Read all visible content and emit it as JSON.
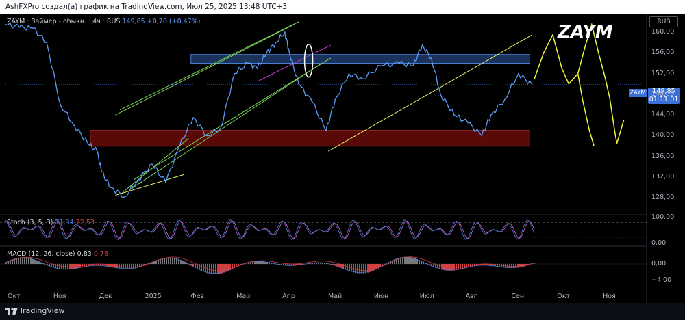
{
  "header": {
    "text": "AshFXPro создал(а) график на TradingView.com, Июл 25, 2025 13:48 UTC+3"
  },
  "legend": {
    "symbol": "ZAYM",
    "description": "· Займер - обыкн. · 4ч · RUS",
    "last": "149,85",
    "change": "+0,70 (+0,47%)"
  },
  "ticker_label": "ZAYM",
  "currency": "RUB",
  "price_tag": {
    "symbol": "ZAYM",
    "price": "149,85",
    "countdown": "01:11:01"
  },
  "stoch": {
    "label": "Stoch (3, 5, 3)",
    "k": "71,34",
    "d": "72,53"
  },
  "macd": {
    "label": "MACD (12, 26, close)",
    "macd": "0,83",
    "signal": "0,78"
  },
  "footer": {
    "brand": "TradingView"
  },
  "colors": {
    "price": "#5b9cf6",
    "accent": "#3a6fd8",
    "zone_support": "#e53935",
    "zone_resistance": "#4a7fd6",
    "channel": "#7cd85a",
    "trendline": "#e5f56a",
    "forecast": "#f2f53d",
    "stoch_k": "#4d78d6",
    "stoch_d": "#c05ec0",
    "macd_pos": "#7a7a7a",
    "macd_neg": "#d04040"
  },
  "chart_data": {
    "type": "line",
    "title": "ZAYM · Займер - обыкн. · 4ч · RUS",
    "x_ticks": [
      "Окт",
      "Ноя",
      "Дек",
      "2025",
      "Фев",
      "Мар",
      "Апр",
      "Май",
      "Июн",
      "Июл",
      "Авг",
      "Сен",
      "Окт",
      "Ноя"
    ],
    "y_ticks": [
      "160,00",
      "156,00",
      "152,00",
      "148,00",
      "144,00",
      "140,00",
      "136,00",
      "132,00",
      "128,00"
    ],
    "ylim": [
      125,
      162
    ],
    "x_domain_months": [
      0,
      14
    ],
    "series": [
      {
        "name": "ZAYM",
        "x": [
          0.0,
          0.3,
          0.6,
          0.9,
          1.2,
          1.5,
          1.8,
          2.0,
          2.1,
          2.3,
          2.6,
          2.9,
          3.2,
          3.5,
          3.8,
          4.1,
          4.4,
          4.7,
          5.0,
          5.3,
          5.5,
          5.7,
          5.9,
          6.1,
          6.2,
          6.4,
          6.7,
          7.0,
          7.2,
          7.5,
          7.8,
          8.2,
          8.6,
          8.9,
          9.1,
          9.3,
          9.5,
          9.8,
          10.1,
          10.4,
          10.6,
          10.9,
          11.2,
          11.5
        ],
        "y": [
          161.5,
          161.0,
          160.8,
          158.0,
          146.0,
          142.0,
          138.5,
          137.0,
          133.0,
          130.0,
          128.2,
          131.5,
          134.5,
          131.0,
          138.0,
          143.5,
          140.0,
          141.5,
          152.0,
          154.0,
          153.0,
          156.0,
          158.0,
          160.0,
          156.0,
          150.0,
          146.5,
          141.0,
          147.0,
          152.0,
          151.0,
          153.5,
          154.0,
          153.5,
          157.5,
          155.0,
          148.0,
          144.0,
          142.5,
          140.0,
          144.0,
          147.0,
          152.0,
          149.85
        ]
      }
    ],
    "annotations": {
      "support_zone": [
        138.0,
        141.0
      ],
      "resistance_zone": [
        154.0,
        155.7
      ]
    },
    "stochastic": {
      "range": [
        0,
        100
      ],
      "ticks": [
        "100,00",
        "0,00"
      ],
      "k_last": 71.34,
      "d_last": 72.53
    },
    "macd": {
      "ticks": [
        "0,00",
        "−4,00"
      ],
      "macd_last": 0.83,
      "signal_last": 0.78
    }
  }
}
